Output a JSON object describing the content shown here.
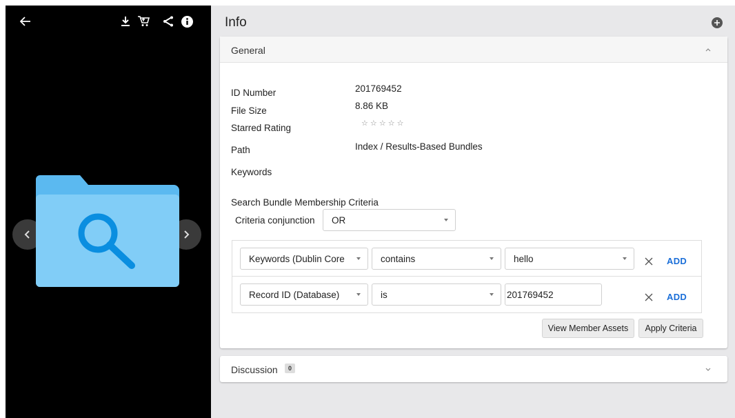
{
  "viewer": {
    "toolbar": [
      "back-arrow-icon",
      "download-icon",
      "cart-icon",
      "share-icon",
      "info-icon"
    ]
  },
  "info": {
    "title": "Info"
  },
  "general": {
    "title": "General",
    "fields": {
      "id_label": "ID Number",
      "id_value": "201769452",
      "size_label": "File Size",
      "size_value": "8.86 KB",
      "rating_label": "Starred Rating",
      "rating_stars": "☆ ☆ ☆ ☆ ☆",
      "path_label": "Path",
      "path_value": "Index / Results-Based Bundles",
      "keywords_label": "Keywords"
    },
    "criteria": {
      "title": "Search Bundle Membership Criteria",
      "conjunction_label": "Criteria conjunction",
      "conjunction_value": "OR",
      "rules": [
        {
          "field": "Keywords (Dublin Core",
          "operator": "contains",
          "value": "hello",
          "add_label": "ADD"
        },
        {
          "field": "Record ID (Database)",
          "operator": "is",
          "value": "201769452",
          "add_label": "ADD"
        }
      ]
    },
    "buttons": {
      "view_members": "View Member Assets",
      "apply": "Apply Criteria"
    }
  },
  "discussion": {
    "title": "Discussion",
    "count": "0"
  },
  "colors": {
    "accent_link": "#1a6ed8",
    "folder_light": "#81cdf7",
    "folder_dark": "#5bb9f0",
    "magnifier": "#0a8ee0"
  }
}
